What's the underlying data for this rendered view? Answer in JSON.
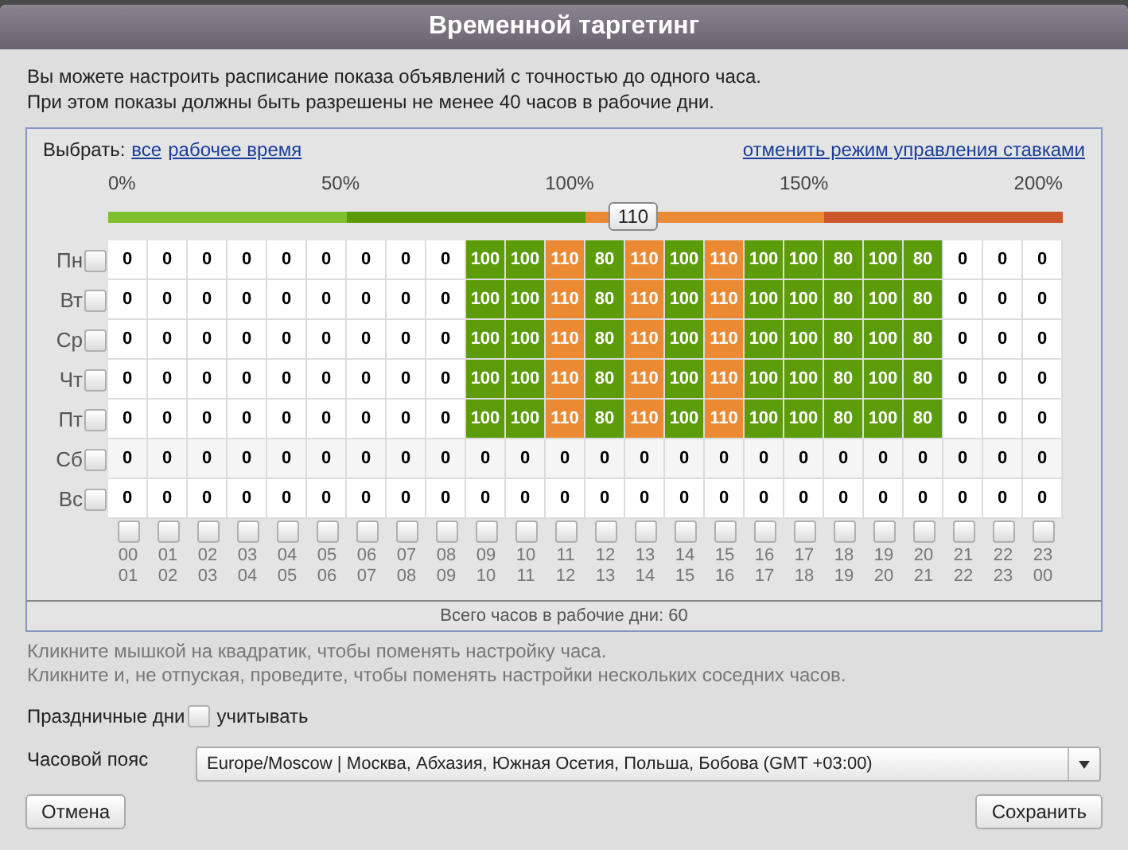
{
  "dialog": {
    "title": "Временной таргетинг"
  },
  "intro": [
    "Вы можете настроить расписание показа объявлений с точностью до одного часа.",
    "При этом показы должны быть разрешены не менее 40 часов в рабочие дни."
  ],
  "select": {
    "label": "Выбрать:",
    "links": [
      "все",
      "рабочее время"
    ]
  },
  "cancel_bid_link": "отменить режим управления ставками",
  "bid_slider": {
    "ticks": [
      "0%",
      "50%",
      "100%",
      "150%",
      "200%"
    ],
    "level": 0.55,
    "value": "110"
  },
  "days": [
    {
      "label": "Пн",
      "checked": false,
      "hours": [
        "0",
        "0",
        "0",
        "0",
        "0",
        "0",
        "0",
        "0",
        "0",
        "100",
        "100",
        "110",
        "80",
        "110",
        "100",
        "110",
        "100",
        "100",
        "80",
        "100",
        "80",
        "0",
        "0",
        "0"
      ]
    },
    {
      "label": "Вт",
      "checked": false,
      "hours": [
        "0",
        "0",
        "0",
        "0",
        "0",
        "0",
        "0",
        "0",
        "0",
        "100",
        "100",
        "110",
        "80",
        "110",
        "100",
        "110",
        "100",
        "100",
        "80",
        "100",
        "80",
        "0",
        "0",
        "0"
      ]
    },
    {
      "label": "Ср",
      "checked": false,
      "hours": [
        "0",
        "0",
        "0",
        "0",
        "0",
        "0",
        "0",
        "0",
        "0",
        "100",
        "100",
        "110",
        "80",
        "110",
        "100",
        "110",
        "100",
        "100",
        "80",
        "100",
        "80",
        "0",
        "0",
        "0"
      ]
    },
    {
      "label": "Чт",
      "checked": false,
      "hours": [
        "0",
        "0",
        "0",
        "0",
        "0",
        "0",
        "0",
        "0",
        "0",
        "100",
        "100",
        "110",
        "80",
        "110",
        "100",
        "110",
        "100",
        "100",
        "80",
        "100",
        "80",
        "0",
        "0",
        "0"
      ]
    },
    {
      "label": "Пт",
      "checked": false,
      "hours": [
        "0",
        "0",
        "0",
        "0",
        "0",
        "0",
        "0",
        "0",
        "0",
        "100",
        "100",
        "110",
        "80",
        "110",
        "100",
        "110",
        "100",
        "100",
        "80",
        "100",
        "80",
        "0",
        "0",
        "0"
      ]
    },
    {
      "label": "Сб",
      "checked": false,
      "hours": [
        "0",
        "0",
        "0",
        "0",
        "0",
        "0",
        "0",
        "0",
        "0",
        "0",
        "0",
        "0",
        "0",
        "0",
        "0",
        "0",
        "0",
        "0",
        "0",
        "0",
        "0",
        "0",
        "0",
        "0"
      ]
    },
    {
      "label": "Вс",
      "checked": false,
      "hours": [
        "0",
        "0",
        "0",
        "0",
        "0",
        "0",
        "0",
        "0",
        "0",
        "0",
        "0",
        "0",
        "0",
        "0",
        "0",
        "0",
        "0",
        "0",
        "0",
        "0",
        "0",
        "0",
        "0",
        "0"
      ]
    }
  ],
  "hour_columns": [
    {
      "from": "00",
      "to": "01",
      "checked": false
    },
    {
      "from": "01",
      "to": "02",
      "checked": false
    },
    {
      "from": "02",
      "to": "03",
      "checked": false
    },
    {
      "from": "03",
      "to": "04",
      "checked": false
    },
    {
      "from": "04",
      "to": "05",
      "checked": false
    },
    {
      "from": "05",
      "to": "06",
      "checked": false
    },
    {
      "from": "06",
      "to": "07",
      "checked": false
    },
    {
      "from": "07",
      "to": "08",
      "checked": false
    },
    {
      "from": "08",
      "to": "09",
      "checked": false
    },
    {
      "from": "09",
      "to": "10",
      "checked": false
    },
    {
      "from": "10",
      "to": "11",
      "checked": false
    },
    {
      "from": "11",
      "to": "12",
      "checked": false
    },
    {
      "from": "12",
      "to": "13",
      "checked": false
    },
    {
      "from": "13",
      "to": "14",
      "checked": false
    },
    {
      "from": "14",
      "to": "15",
      "checked": false
    },
    {
      "from": "15",
      "to": "16",
      "checked": false
    },
    {
      "from": "16",
      "to": "17",
      "checked": false
    },
    {
      "from": "17",
      "to": "18",
      "checked": false
    },
    {
      "from": "18",
      "to": "19",
      "checked": false
    },
    {
      "from": "19",
      "to": "20",
      "checked": false
    },
    {
      "from": "20",
      "to": "21",
      "checked": false
    },
    {
      "from": "21",
      "to": "22",
      "checked": false
    },
    {
      "from": "22",
      "to": "23",
      "checked": false
    },
    {
      "from": "23",
      "to": "00",
      "checked": false
    }
  ],
  "total": "Всего часов в рабочие дни: 60",
  "hints": [
    "Кликните мышкой на квадратик, чтобы поменять настройку часа.",
    "Кликните и, не отпуская, проведите, чтобы поменять настройки нескольких соседних часов."
  ],
  "holidays": {
    "label": "Праздничные дни",
    "checkbox_label": "учитывать",
    "checked": false
  },
  "timezone": {
    "label": "Часовой пояс",
    "value": "Europe/Moscow | Москва, Абхазия, Южная Осетия, Польша, Бобова (GMT +03:00)"
  },
  "buttons": [
    {
      "label": "Отмена"
    },
    {
      "label": "Сохранить"
    }
  ]
}
